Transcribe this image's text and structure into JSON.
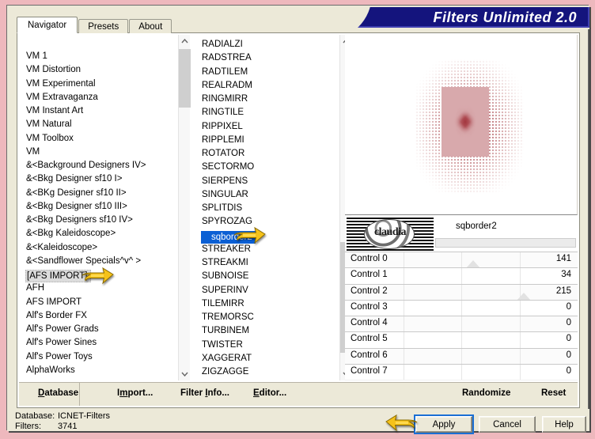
{
  "window": {
    "title": "Filters Unlimited 2.0",
    "accent_navy": "#14147d",
    "outer_border_color": "#eeb8bd"
  },
  "tabs": [
    {
      "label": "Navigator",
      "active": true
    },
    {
      "label": "Presets",
      "active": false
    },
    {
      "label": "About",
      "active": false
    }
  ],
  "category_list": {
    "name": "filter-category-list",
    "selected": "[AFS IMPORT]",
    "items": [
      "VM 1",
      "VM Distortion",
      "VM Experimental",
      "VM Extravaganza",
      "VM Instant Art",
      "VM Natural",
      "VM Toolbox",
      "VM",
      "&<Background Designers IV>",
      "&<Bkg Designer sf10 I>",
      "&<BKg Designer sf10 II>",
      "&<Bkg Designer sf10 III>",
      "&<Bkg Designers sf10 IV>",
      "&<Bkg Kaleidoscope>",
      "&<Kaleidoscope>",
      "&<Sandflower Specials^v^ >",
      "[AFS IMPORT]",
      "AFH",
      "AFS IMPORT",
      "Alf's Border FX",
      "Alf's Power Grads",
      "Alf's Power Sines",
      "Alf's Power Toys",
      "AlphaWorks"
    ]
  },
  "filter_list": {
    "name": "filter-name-list",
    "selected": "sqborder2",
    "items": [
      "RADIALZI",
      "RADSTREA",
      "RADTILEM",
      "REALRADM",
      "RINGMIRR",
      "RINGTILE",
      "RIPPIXEL",
      "RIPPLEMI",
      "ROTATOR",
      "SECTORMO",
      "SIERPENS",
      "SINGULAR",
      "SPLITDIS",
      "SPYROZAG",
      "sqborder2",
      "STREAKER",
      "STREAKMI",
      "SUBNOISE",
      "SUPERINV",
      "TILEMIRR",
      "TREMORSC",
      "TURBINEM",
      "TWISTER",
      "XAGGERAT",
      "ZIGZAGGE"
    ]
  },
  "controls_panel": {
    "logo_text": "claudia",
    "preset_name": "sqborder2",
    "rows": [
      {
        "label": "Control 0",
        "value": "141",
        "marker_pct": 55
      },
      {
        "label": "Control 1",
        "value": "34",
        "marker_pct": -1
      },
      {
        "label": "Control 2",
        "value": "215",
        "marker_pct": 77
      },
      {
        "label": "Control 3",
        "value": "0",
        "marker_pct": -1
      },
      {
        "label": "Control 4",
        "value": "0",
        "marker_pct": -1
      },
      {
        "label": "Control 5",
        "value": "0",
        "marker_pct": -1
      },
      {
        "label": "Control 6",
        "value": "0",
        "marker_pct": -1
      },
      {
        "label": "Control 7",
        "value": "0",
        "marker_pct": -1
      }
    ]
  },
  "panel_buttons": {
    "database": "Database",
    "import": "Import...",
    "filter_info": "Filter Info...",
    "editor": "Editor...",
    "randomize": "Randomize",
    "reset": "Reset"
  },
  "footer": {
    "database_key": "Database:",
    "database_value": "ICNET-Filters",
    "filters_key": "Filters:",
    "filters_value": "3741",
    "apply": "Apply",
    "cancel": "Cancel",
    "help": "Help"
  },
  "scrollbars": {
    "left_up": "▲",
    "left_down": "▼",
    "mid_up": "▲",
    "mid_down": "▼"
  }
}
